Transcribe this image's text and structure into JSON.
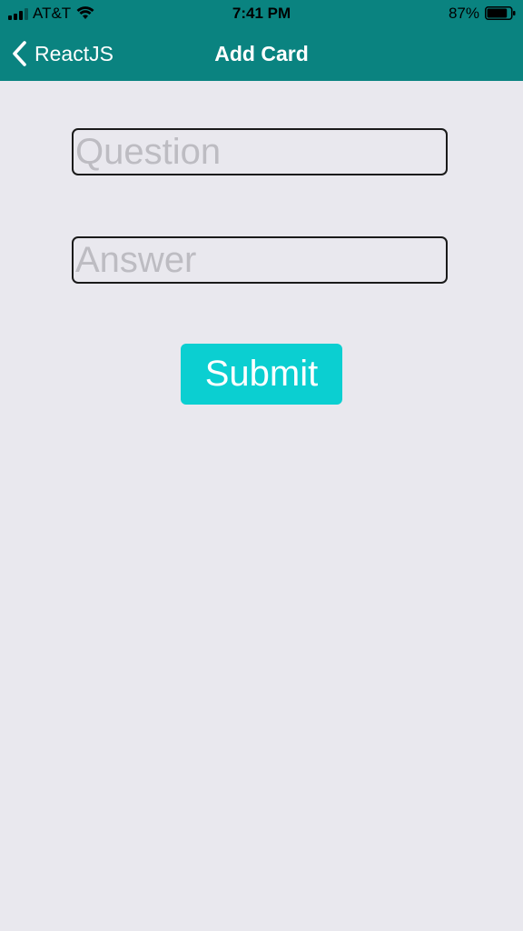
{
  "status_bar": {
    "carrier": "AT&T",
    "time": "7:41 PM",
    "battery_percent": "87%",
    "battery_level": 0.87,
    "signal_bars": 3,
    "signal_total": 4
  },
  "nav": {
    "back_label": "ReactJS",
    "title": "Add Card"
  },
  "form": {
    "question_placeholder": "Question",
    "question_value": "",
    "answer_placeholder": "Answer",
    "answer_value": "",
    "submit_label": "Submit"
  },
  "colors": {
    "header": "#0a8380",
    "background": "#e9e8ee",
    "submit": "#0bcfd1",
    "placeholder": "#bdbcc2"
  }
}
